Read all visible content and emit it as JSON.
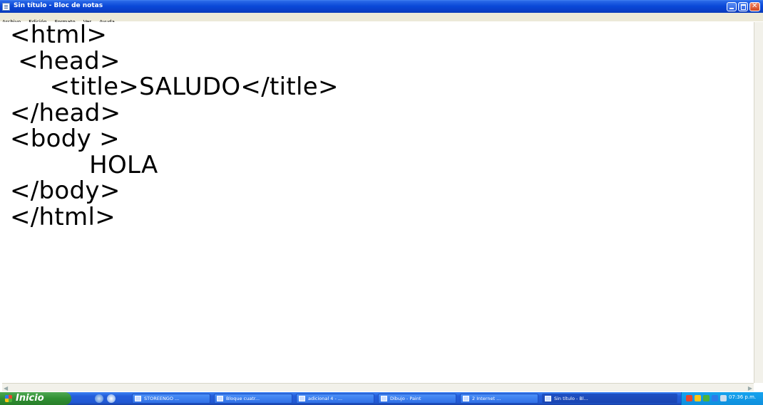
{
  "window": {
    "title": "Sin título - Bloc de notas"
  },
  "menu": [
    "Archivo",
    "Edición",
    "Formato",
    "Ver",
    "Ayuda"
  ],
  "editor": {
    "lines": [
      "<html>",
      " <head>",
      "     <title>SALUDO</title>",
      "</head>",
      "<body >",
      "          HOLA",
      "</body>",
      "</html>"
    ]
  },
  "taskbar": {
    "start_label": "Inicio",
    "tasks": [
      {
        "label": "STOREENGO ..."
      },
      {
        "label": "Bloque cuatr..."
      },
      {
        "label": "adicional 4 - ..."
      },
      {
        "label": "Dibujo - Paint"
      },
      {
        "label": "2 Internet ..."
      },
      {
        "label": "Sin título - Bl..."
      }
    ],
    "clock": "07:36 p.m."
  },
  "colors": {
    "titlebar": "#0a48d8",
    "taskbar": "#245edb",
    "start": "#2f8f32",
    "tray": "#0f8fdd",
    "menubar": "#ece9d8"
  }
}
